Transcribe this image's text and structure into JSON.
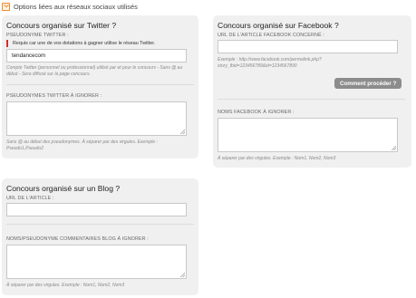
{
  "header": {
    "title": "Options liées aux réseaux sociaux utilisés",
    "icon": "collapse-toggle-icon"
  },
  "twitter": {
    "title": "Concours organisé sur Twitter ?",
    "username_label": "PSEUDONYME TWITTER :",
    "notice": "Requis car une de vos dotations à gagner utilise le réseau Twitter.",
    "username_value": "tendancecom",
    "username_hint": "Compte Twitter (personnel ou professionnel) utilisé par et pour le concours - Sans @ au début - Sera diffusé sur la page concours.",
    "ignore_label": "PSEUDONYMES TWITTER À IGNORER :",
    "ignore_value": "",
    "ignore_hint": "Sans @ au début des pseudonymes. À séparer par des virgules. Exemple : Pseudo1,Pseudo2"
  },
  "facebook": {
    "title": "Concours organisé sur Facebook ?",
    "url_label": "URL DE L'ARTICLE FACEBOOK CONCERNÉ :",
    "url_value": "",
    "url_hint": "Exemple : http://www.facebook.com/permalink.php?story_fbid=123456789&id=1234567890",
    "how_button": "Comment procéder ?",
    "ignore_label": "NOMS FACEBOOK À IGNORER :",
    "ignore_value": "",
    "ignore_hint": "À séparer par des virgules. Exemple : Nom1, Nom2, Nom3"
  },
  "blog": {
    "title": "Concours organisé sur un Blog ?",
    "url_label": "URL DE L'ARTICLE :",
    "url_value": "",
    "ignore_label": "NOMS/PSEUDONYME COMMENTAIRES BLOG À IGNORER :",
    "ignore_value": "",
    "ignore_hint": "À séparer par des virgules. Exemple : Nom1, Nom2, Nom3"
  }
}
